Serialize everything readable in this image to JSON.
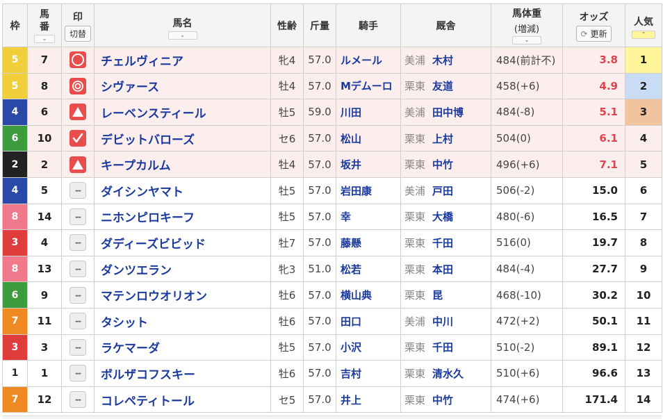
{
  "header": {
    "waku": "枠",
    "umaban_1": "馬",
    "umaban_2": "番",
    "mark": "印",
    "mark_toggle": "切替",
    "name": "馬名",
    "sexage": "性齢",
    "kinryo": "斤量",
    "jockey": "騎手",
    "stable": "厩舎",
    "weight": "馬体重",
    "weight_sub": "(増減)",
    "odds": "オッズ",
    "odds_refresh": "更新",
    "popularity": "人気"
  },
  "colors": {
    "w1": "#ffffff",
    "w2": "#222222",
    "w3": "#e03c3c",
    "w4": "#2b4aa8",
    "w5": "#f0cf3a",
    "w6": "#3d9c3d",
    "w7": "#ef8a23",
    "w8": "#f07a8c",
    "pop1": "#fff69a",
    "pop2": "#c9dcf6",
    "pop3": "#f2c49d",
    "highlight_row": "#fdeeee",
    "odds_hot": "#e0434d",
    "link": "#1a3a9e"
  },
  "rows": [
    {
      "waku": "5",
      "num": "7",
      "mark": "double-circle",
      "name": "チェルヴィニア",
      "sex": "牝4",
      "kin": "57.0",
      "jockey": "ルメール",
      "region": "美浦",
      "trainer": "木村",
      "weight": "484(前計不)",
      "odds": "3.8",
      "pop": "1"
    },
    {
      "waku": "5",
      "num": "8",
      "mark": "circle",
      "name": "シヴァース",
      "sex": "牡4",
      "kin": "57.0",
      "jockey": "Mデムーロ",
      "region": "栗東",
      "trainer": "友道",
      "weight": "458(+6)",
      "odds": "4.9",
      "pop": "2"
    },
    {
      "waku": "4",
      "num": "6",
      "mark": "triangle",
      "name": "レーベンスティール",
      "sex": "牡5",
      "kin": "59.0",
      "jockey": "川田",
      "region": "美浦",
      "trainer": "田中博",
      "weight": "484(-8)",
      "odds": "5.1",
      "pop": "3"
    },
    {
      "waku": "6",
      "num": "10",
      "mark": "check",
      "name": "デビットバローズ",
      "sex": "セ6",
      "kin": "57.0",
      "jockey": "松山",
      "region": "栗東",
      "trainer": "上村",
      "weight": "504(0)",
      "odds": "6.1",
      "pop": "4"
    },
    {
      "waku": "2",
      "num": "2",
      "mark": "triangle",
      "name": "キープカルム",
      "sex": "牡4",
      "kin": "57.0",
      "jockey": "坂井",
      "region": "栗東",
      "trainer": "中竹",
      "weight": "496(+6)",
      "odds": "7.1",
      "pop": "5"
    },
    {
      "waku": "4",
      "num": "5",
      "mark": "none",
      "name": "ダイシンヤマト",
      "sex": "牡5",
      "kin": "57.0",
      "jockey": "岩田康",
      "region": "美浦",
      "trainer": "戸田",
      "weight": "506(-2)",
      "odds": "15.0",
      "pop": "6"
    },
    {
      "waku": "8",
      "num": "14",
      "mark": "none",
      "name": "ニホンピロキーフ",
      "sex": "牡5",
      "kin": "57.0",
      "jockey": "幸",
      "region": "栗東",
      "trainer": "大橋",
      "weight": "480(-6)",
      "odds": "16.5",
      "pop": "7"
    },
    {
      "waku": "3",
      "num": "4",
      "mark": "none",
      "name": "ダディーズビビッド",
      "sex": "牡7",
      "kin": "57.0",
      "jockey": "藤懸",
      "region": "栗東",
      "trainer": "千田",
      "weight": "516(0)",
      "odds": "19.7",
      "pop": "8"
    },
    {
      "waku": "8",
      "num": "13",
      "mark": "none",
      "name": "ダンツエラン",
      "sex": "牝3",
      "kin": "51.0",
      "jockey": "松若",
      "region": "栗東",
      "trainer": "本田",
      "weight": "484(-4)",
      "odds": "27.7",
      "pop": "9"
    },
    {
      "waku": "6",
      "num": "9",
      "mark": "none",
      "name": "マテンロウオリオン",
      "sex": "牡6",
      "kin": "57.0",
      "jockey": "横山典",
      "region": "栗東",
      "trainer": "昆",
      "weight": "468(-10)",
      "odds": "30.2",
      "pop": "10"
    },
    {
      "waku": "7",
      "num": "11",
      "mark": "none",
      "name": "タシット",
      "sex": "牡6",
      "kin": "57.0",
      "jockey": "田口",
      "region": "美浦",
      "trainer": "中川",
      "weight": "472(+2)",
      "odds": "50.1",
      "pop": "11"
    },
    {
      "waku": "3",
      "num": "3",
      "mark": "none",
      "name": "ラケマーダ",
      "sex": "牡5",
      "kin": "57.0",
      "jockey": "小沢",
      "region": "栗東",
      "trainer": "千田",
      "weight": "510(-2)",
      "odds": "89.1",
      "pop": "12"
    },
    {
      "waku": "1",
      "num": "1",
      "mark": "none",
      "name": "ボルザコフスキー",
      "sex": "牡6",
      "kin": "57.0",
      "jockey": "吉村",
      "region": "栗東",
      "trainer": "清水久",
      "weight": "510(+6)",
      "odds": "96.6",
      "pop": "13"
    },
    {
      "waku": "7",
      "num": "12",
      "mark": "none",
      "name": "コレペティトール",
      "sex": "セ5",
      "kin": "57.0",
      "jockey": "井上",
      "region": "栗東",
      "trainer": "中竹",
      "weight": "474(+6)",
      "odds": "171.4",
      "pop": "14"
    }
  ]
}
